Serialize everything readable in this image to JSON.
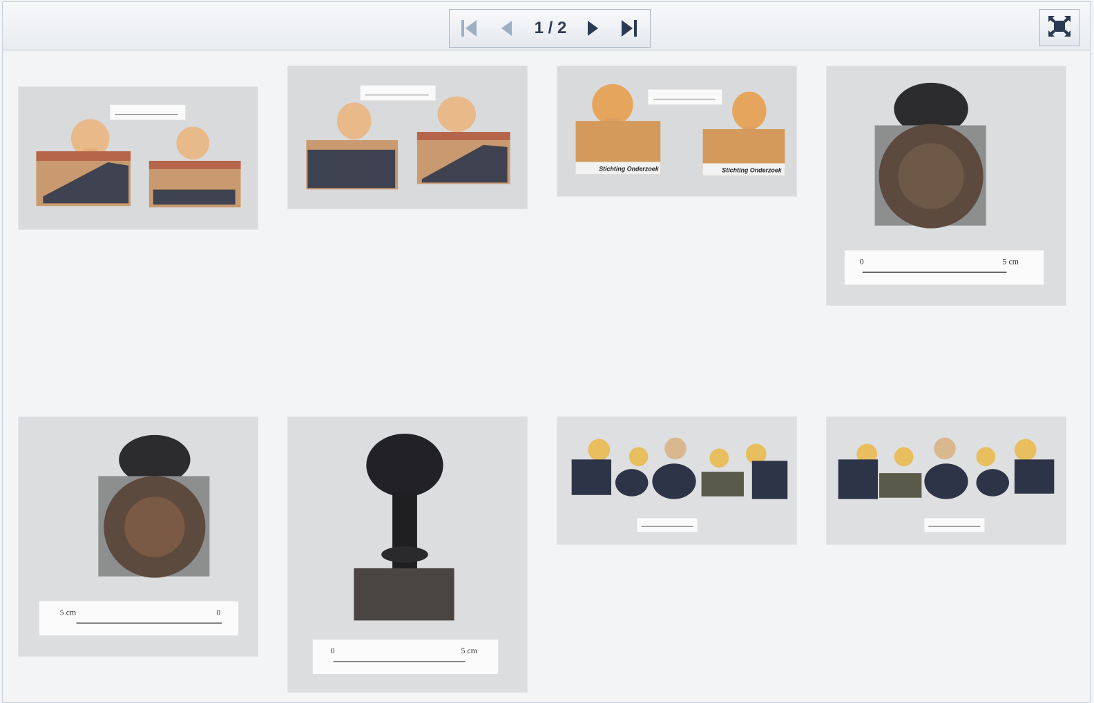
{
  "pager": {
    "counter": "1 / 2",
    "first_icon": "first-page-icon",
    "prev_icon": "previous-page-icon",
    "next_icon": "next-page-icon",
    "last_icon": "last-page-icon"
  },
  "fullscreen": {
    "icon": "fullscreen-icon"
  },
  "colors": {
    "toolbar_bg": "#eceff3",
    "icon_active": "#2a3a52",
    "icon_disabled": "#9fb0c4",
    "page_bg": "#f3f4f6"
  },
  "thumbnails": [
    {
      "id": "thumb-1",
      "subject": "two-wooden-rubber-stamps-ajc"
    },
    {
      "id": "thumb-2",
      "subject": "two-wooden-rubber-stamps-ajc-side"
    },
    {
      "id": "thumb-3",
      "subject": "two-wooden-stamps-stichting-onderzoek",
      "texts": [
        "Stichting Onderzoek",
        "Stichting Onderzoek"
      ]
    },
    {
      "id": "thumb-4",
      "subject": "black-seal-stamp-with-ruler",
      "ruler": [
        "0",
        "5 cm"
      ]
    },
    {
      "id": "thumb-5",
      "subject": "black-seal-stamp-with-ruler-upside",
      "ruler": [
        "5 cm",
        "0"
      ]
    },
    {
      "id": "thumb-6",
      "subject": "black-handle-seal-stamp-with-ruler",
      "ruler": [
        "0",
        "5 cm"
      ]
    },
    {
      "id": "thumb-7",
      "subject": "five-small-stamps-row"
    },
    {
      "id": "thumb-8",
      "subject": "five-small-stamps-row-alt"
    }
  ]
}
